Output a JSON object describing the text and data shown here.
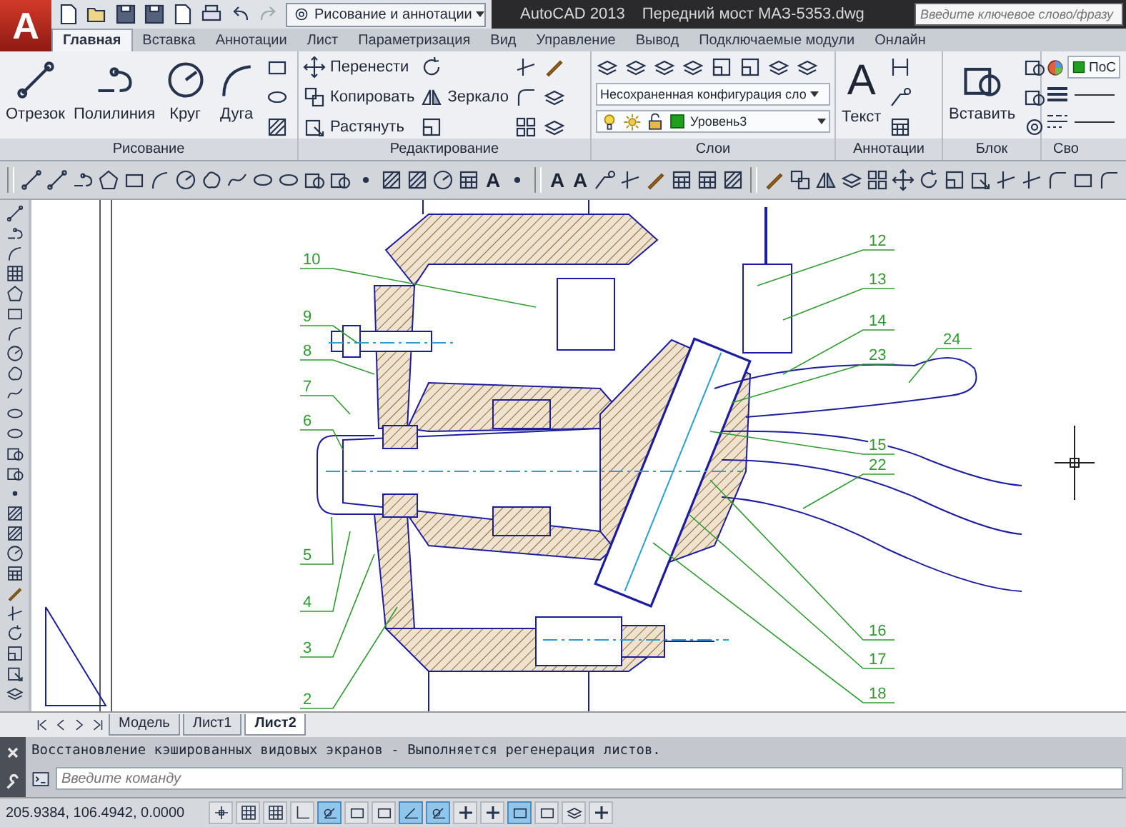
{
  "app_menu": {
    "logo": "A"
  },
  "quick_access": {
    "workspace": "Рисование и аннотации"
  },
  "title_bar": {
    "app": "AutoCAD 2013",
    "file": "Передний мост МАЗ-5353.dwg",
    "search": {
      "placeholder": "Введите ключевое слово/фразу"
    }
  },
  "tabs": [
    {
      "label": "Главная",
      "selected": true
    },
    {
      "label": "Вставка",
      "selected": false
    },
    {
      "label": "Аннотации",
      "selected": false
    },
    {
      "label": "Лист",
      "selected": false
    },
    {
      "label": "Параметризация",
      "selected": false
    },
    {
      "label": "Вид",
      "selected": false
    },
    {
      "label": "Управление",
      "selected": false
    },
    {
      "label": "Вывод",
      "selected": false
    },
    {
      "label": "Подключаемые модули",
      "selected": false
    },
    {
      "label": "Онлайн",
      "selected": false
    }
  ],
  "draw_panel": {
    "title": "Рисование",
    "tools": [
      "Отрезок",
      "Полилиния",
      "Круг",
      "Дуга"
    ]
  },
  "modify_panel": {
    "title": "Редактирование",
    "tools": [
      "Перенести",
      "Копировать",
      "Растянуть",
      "Зеркало"
    ]
  },
  "layers_panel": {
    "title": "Слои",
    "layer_state": "Несохраненная конфигурация сло",
    "current_layer": "Уровень3"
  },
  "annotation_panel": {
    "title": "Аннотации",
    "glyph": "A",
    "tool": "Текст"
  },
  "block_panel": {
    "title": "Блок",
    "tool": "Вставить"
  },
  "properties_panel": {
    "title": "Сво",
    "color_name": "ПоС"
  },
  "toolbars": {
    "draw_glyph": "A",
    "text_glyphs": [
      "A",
      "A"
    ]
  },
  "drawing": {
    "callouts": [
      "10",
      "9",
      "8",
      "7",
      "6",
      "5",
      "4",
      "3",
      "2",
      "12",
      "13",
      "14",
      "23",
      "24",
      "15",
      "22",
      "16",
      "17",
      "18"
    ]
  },
  "layout_tabs": [
    {
      "label": "Модель",
      "selected": false
    },
    {
      "label": "Лист1",
      "selected": false
    },
    {
      "label": "Лист2",
      "selected": true
    }
  ],
  "command_line": {
    "history": "Восстановление кэшированных видовых экранов - Выполняется регенерация листов.",
    "placeholder": "Введите команду"
  },
  "status_bar": {
    "coordinates": "205.9384, 106.4942, 0.0000",
    "toggles": [
      {
        "on": false
      },
      {
        "on": false
      },
      {
        "on": false
      },
      {
        "on": false
      },
      {
        "on": true
      },
      {
        "on": false
      },
      {
        "on": false
      },
      {
        "on": true
      },
      {
        "on": true
      },
      {
        "on": false
      },
      {
        "on": false
      },
      {
        "on": true
      },
      {
        "on": false
      },
      {
        "on": false
      },
      {
        "on": false
      }
    ]
  }
}
